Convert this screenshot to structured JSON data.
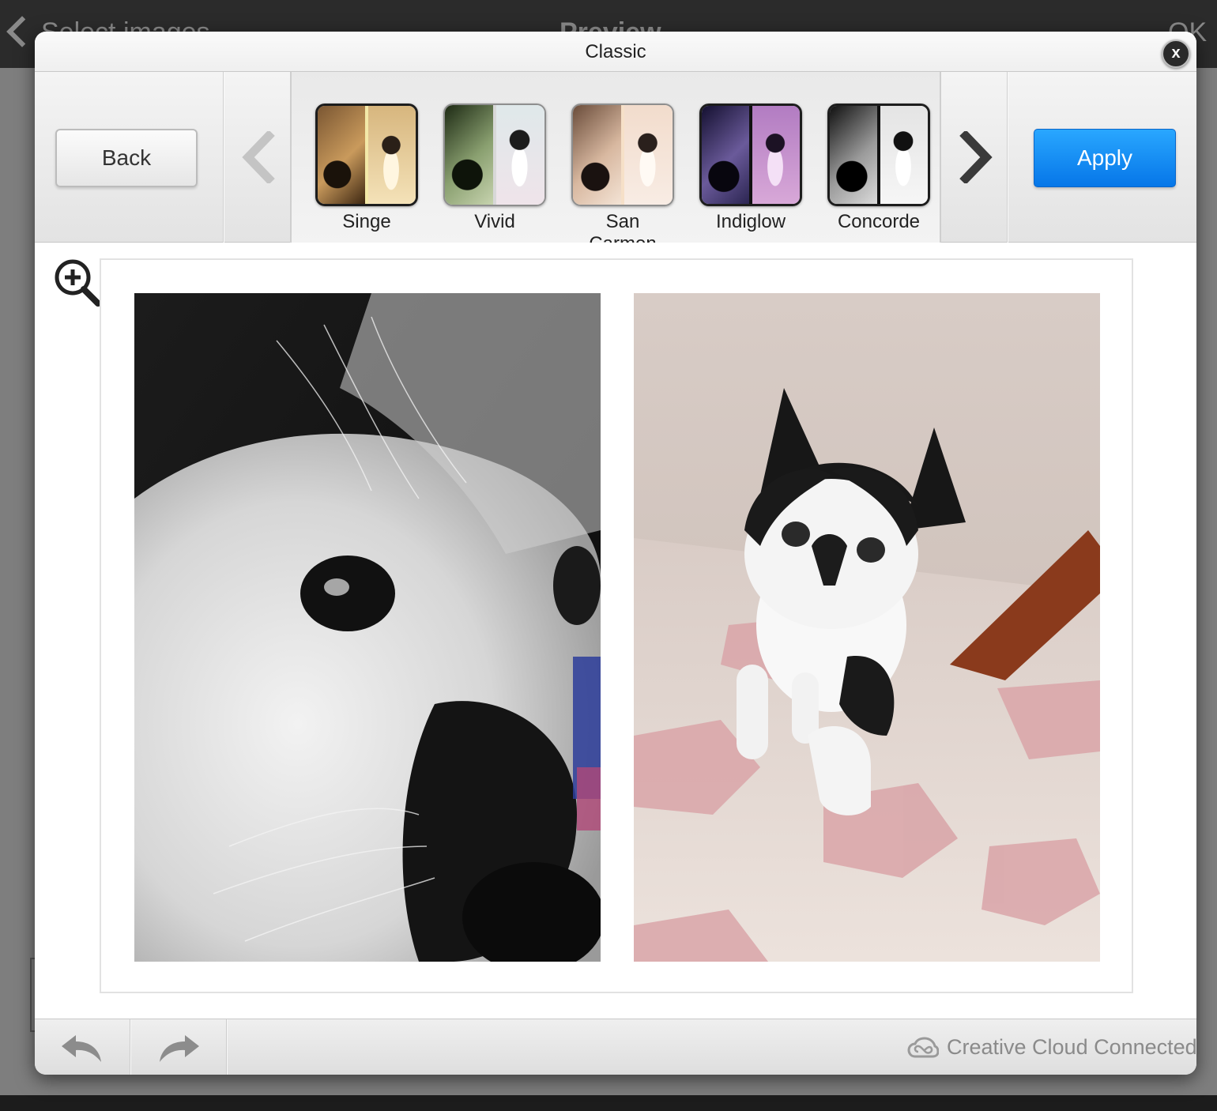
{
  "background": {
    "left_title": "Select images",
    "center_title": "Preview",
    "right_title": "OK"
  },
  "modal": {
    "title": "Classic",
    "close_label": "x"
  },
  "toolbar": {
    "back_label": "Back",
    "apply_label": "Apply",
    "prev_icon": "chevron-left-icon",
    "next_icon": "chevron-right-icon",
    "filters": [
      {
        "label": "Singe",
        "left_color": "#5a3a20",
        "right_color": "#f4e2b8"
      },
      {
        "label": "Vivid",
        "left_color": "#2e4a22",
        "right_color": "#e6eef0"
      },
      {
        "label": "San Carmen",
        "left_color": "#7a5a44",
        "right_color": "#f6e6da"
      },
      {
        "label": "Indiglow",
        "left_color": "#2a2244",
        "right_color": "#c79ad0"
      },
      {
        "label": "Concorde",
        "left_color": "#232323",
        "right_color": "#efefef"
      }
    ]
  },
  "preview": {
    "zoom_icon": "zoom-in-icon",
    "left_image": "kitten-closeup",
    "right_image": "kitten-walking"
  },
  "footer": {
    "undo_icon": "undo-icon",
    "redo_icon": "redo-icon",
    "cc_icon": "creative-cloud-icon",
    "cc_label": "Creative Cloud Connected"
  }
}
